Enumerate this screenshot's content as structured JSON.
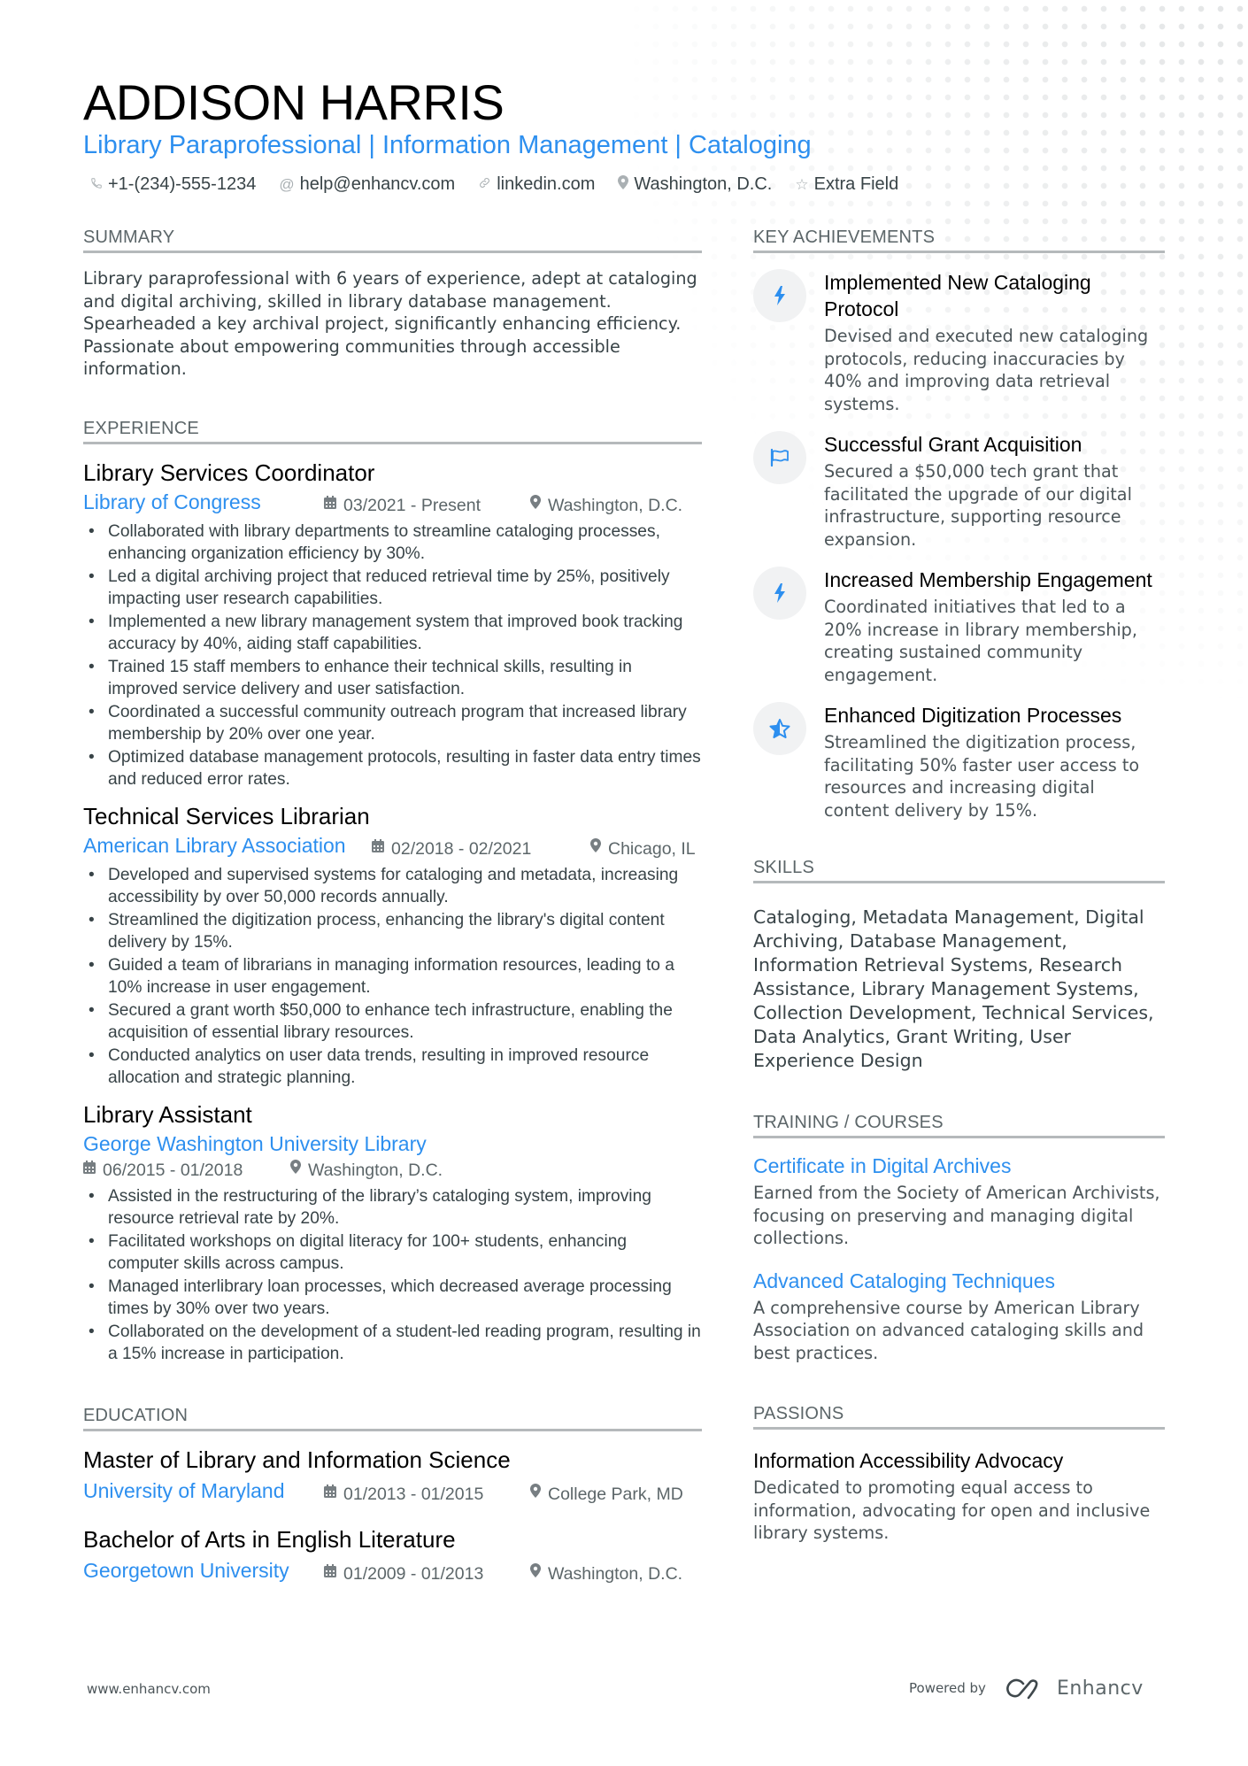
{
  "header": {
    "name": "ADDISON HARRIS",
    "headline": "Library Paraprofessional | Information Management | Cataloging",
    "contacts": [
      {
        "icon": "phone-icon",
        "glyph": "✆",
        "text": "+1-(234)-555-1234"
      },
      {
        "icon": "at-icon",
        "glyph": "@",
        "text": "help@enhancv.com"
      },
      {
        "icon": "link-icon",
        "glyph": "🔗",
        "text": "linkedin.com"
      },
      {
        "icon": "location-pin-icon",
        "glyph": "⚲",
        "text": "Washington, D.C."
      },
      {
        "icon": "star-icon",
        "glyph": "☆",
        "text": "Extra Field"
      }
    ]
  },
  "summary": {
    "title": "SUMMARY",
    "text": "Library paraprofessional with 6 years of experience, adept at cataloging and digital archiving, skilled in library database management. Spearheaded a key archival project, significantly enhancing efficiency. Passionate about empowering communities through accessible information."
  },
  "experience": {
    "title": "EXPERIENCE",
    "jobs": [
      {
        "role": "Library Services Coordinator",
        "company": "Library of Congress",
        "dates": "03/2021 - Present",
        "location": "Washington, D.C.",
        "bullets": [
          "Collaborated with library departments to streamline cataloging processes, enhancing organization efficiency by 30%.",
          "Led a digital archiving project that reduced retrieval time by 25%, positively impacting user research capabilities.",
          "Implemented a new library management system that improved book tracking accuracy by 40%, aiding staff capabilities.",
          "Trained 15 staff members to enhance their technical skills, resulting in improved service delivery and user satisfaction.",
          "Coordinated a successful community outreach program that increased library membership by 20% over one year.",
          "Optimized database management protocols, resulting in faster data entry times and reduced error rates."
        ]
      },
      {
        "role": "Technical Services Librarian",
        "company": "American Library Association",
        "dates": "02/2018 - 02/2021",
        "location": "Chicago, IL",
        "bullets": [
          "Developed and supervised systems for cataloging and metadata, increasing accessibility by over 50,000 records annually.",
          "Streamlined the digitization process, enhancing the library's digital content delivery by 15%.",
          "Guided a team of librarians in managing information resources, leading to a 10% increase in user engagement.",
          "Secured a grant worth $50,000 to enhance tech infrastructure, enabling the acquisition of essential library resources.",
          "Conducted analytics on user data trends, resulting in improved resource allocation and strategic planning."
        ]
      },
      {
        "role": "Library Assistant",
        "company": "George Washington University Library",
        "dates": "06/2015 - 01/2018",
        "location": "Washington, D.C.",
        "bullets": [
          "Assisted in the restructuring of the library’s cataloging system, improving resource retrieval rate by 20%.",
          "Facilitated workshops on digital literacy for 100+ students, enhancing computer skills across campus.",
          "Managed interlibrary loan processes, which decreased average processing times by 30% over two years.",
          "Collaborated on the development of a student-led reading program, resulting in a 15% increase in participation."
        ]
      }
    ]
  },
  "education": {
    "title": "EDUCATION",
    "items": [
      {
        "degree": "Master of Library and Information Science",
        "school": "University of Maryland",
        "dates": "01/2013 - 01/2015",
        "location": "College Park, MD"
      },
      {
        "degree": "Bachelor of Arts in English Literature",
        "school": "Georgetown University",
        "dates": "01/2009 - 01/2013",
        "location": "Washington, D.C."
      }
    ]
  },
  "achievements": {
    "title": "KEY ACHIEVEMENTS",
    "items": [
      {
        "icon": "bolt-icon",
        "title": "Implemented New Cataloging Protocol",
        "desc": "Devised and executed new cataloging protocols, reducing inaccuracies by 40% and improving data retrieval systems."
      },
      {
        "icon": "flag-icon",
        "title": "Successful Grant Acquisition",
        "desc": "Secured a $50,000 tech grant that facilitated the upgrade of our digital infrastructure, supporting resource expansion."
      },
      {
        "icon": "bolt-icon",
        "title": "Increased Membership Engagement",
        "desc": "Coordinated initiatives that led to a 20% increase in library membership, creating sustained community engagement."
      },
      {
        "icon": "half-star-icon",
        "title": "Enhanced Digitization Processes",
        "desc": "Streamlined the digitization process, facilitating 50% faster user access to resources and increasing digital content delivery by 15%."
      }
    ]
  },
  "skills": {
    "title": "SKILLS",
    "text": "Cataloging, Metadata Management, Digital Archiving, Database Management, Information Retrieval Systems, Research Assistance, Library Management Systems, Collection Development, Technical Services, Data Analytics, Grant Writing, User Experience Design"
  },
  "training": {
    "title": "TRAINING / COURSES",
    "items": [
      {
        "title": "Certificate in Digital Archives",
        "desc": "Earned from the Society of American Archivists, focusing on preserving and managing digital collections."
      },
      {
        "title": "Advanced Cataloging Techniques",
        "desc": "A comprehensive course by American Library Association on advanced cataloging skills and best practices."
      }
    ]
  },
  "passions": {
    "title": "PASSIONS",
    "items": [
      {
        "title": "Information Accessibility Advocacy",
        "desc": "Dedicated to promoting equal access to information, advocating for open and inclusive library systems."
      }
    ]
  },
  "footer": {
    "website": "www.enhancv.com",
    "powered_by": "Powered by",
    "brand": "Enhancv"
  },
  "colors": {
    "accent": "#2d8fef",
    "text": "#384347",
    "heading": "#000000",
    "muted": "#5c6669",
    "rule": "#b5b9bb",
    "icon_bg": "#f1f2f3"
  }
}
